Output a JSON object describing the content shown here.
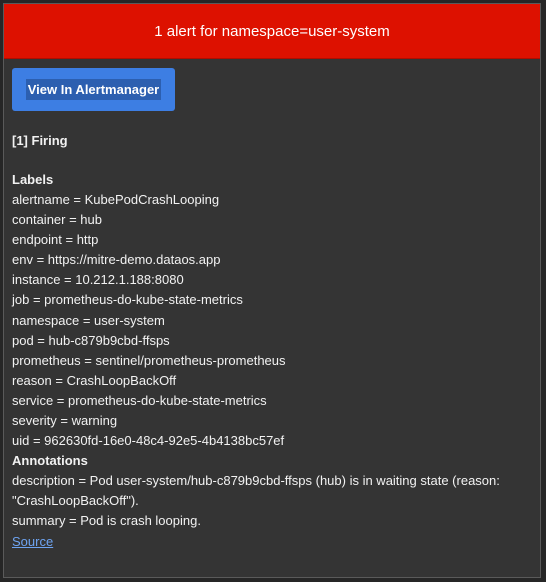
{
  "banner": {
    "title": "1 alert for namespace=user-system"
  },
  "actions": {
    "view_button_label": "View In Alertmanager"
  },
  "alert": {
    "firing_heading": "[1] Firing",
    "labels_heading": "Labels",
    "labels": [
      "alertname = KubePodCrashLooping",
      "container = hub",
      "endpoint = http",
      "env = https://mitre-demo.dataos.app",
      "instance = 10.212.1.188:8080",
      "job = prometheus-do-kube-state-metrics",
      "namespace = user-system",
      "pod = hub-c879b9cbd-ffsps",
      "prometheus = sentinel/prometheus-prometheus",
      "reason = CrashLoopBackOff",
      "service = prometheus-do-kube-state-metrics",
      "severity = warning",
      "uid = 962630fd-16e0-48c4-92e5-4b4138bc57ef"
    ],
    "annotations_heading": "Annotations",
    "annotations": [
      "description = Pod user-system/hub-c879b9cbd-ffsps (hub) is in waiting state (reason: \"CrashLoopBackOff\").",
      "summary = Pod is crash looping."
    ],
    "source_link": "Source"
  },
  "colors": {
    "banner_bg": "#dd1100",
    "button_bg": "#3d7ee3",
    "link": "#6ea4f2",
    "panel_bg": "#343434"
  }
}
